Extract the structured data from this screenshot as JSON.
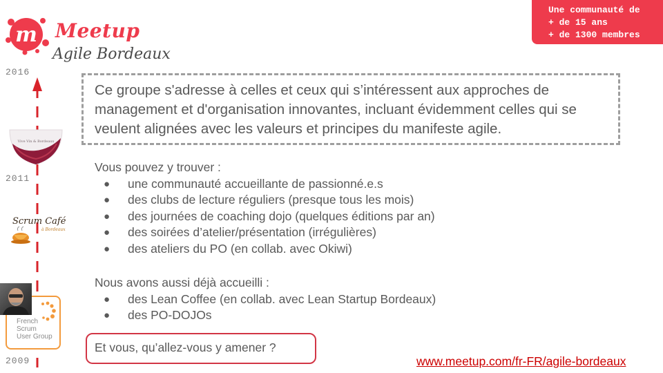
{
  "badge": {
    "lines": [
      "Une communauté de",
      "+ de 15 ans",
      "+ de 1300 membres"
    ]
  },
  "logo": {
    "letter": "m",
    "wordmark": "Meetup",
    "subtitle": "Agile Bordeaux"
  },
  "timeline": {
    "years": [
      "2016",
      "2011",
      "2009"
    ],
    "wine_caption": "Vive Vin & Bordeaux",
    "scrum_cafe": {
      "title": "Scrum Café",
      "subtitle": "à Bordeaux"
    },
    "fsug_lines": [
      "French",
      "Scrum",
      "User Group"
    ]
  },
  "quote": "Ce groupe s'adresse à celles et ceux qui s’intéressent aux approches de management et d'organisation innovantes, incluant évidemment celles qui se veulent alignées avec les valeurs et principes du manifeste agile.",
  "find": {
    "title": "Vous pouvez y trouver :",
    "items": [
      "une communauté accueillante de passionné.e.s",
      "des clubs de lecture réguliers (presque tous les mois)",
      "des journées de coaching dojo (quelques éditions par an)",
      "des soirées d’atelier/présentation (irrégulières)",
      "des ateliers du PO (en collab. avec Okiwi)"
    ]
  },
  "hosted": {
    "title": "Nous avons aussi déjà accueilli :",
    "items": [
      "des Lean Coffee (en collab. avec Lean Startup Bordeaux)",
      "des PO-DOJOs"
    ]
  },
  "bullet": "●",
  "cta": "Et vous, qu’allez-vous y amener ?",
  "link": "www.meetup.com/fr-FR/agile-bordeaux",
  "colors": {
    "brand_red": "#ee3b4c",
    "text_gray": "#595959",
    "dash_gray": "#9e9e9e",
    "link_red": "#cc0000"
  }
}
